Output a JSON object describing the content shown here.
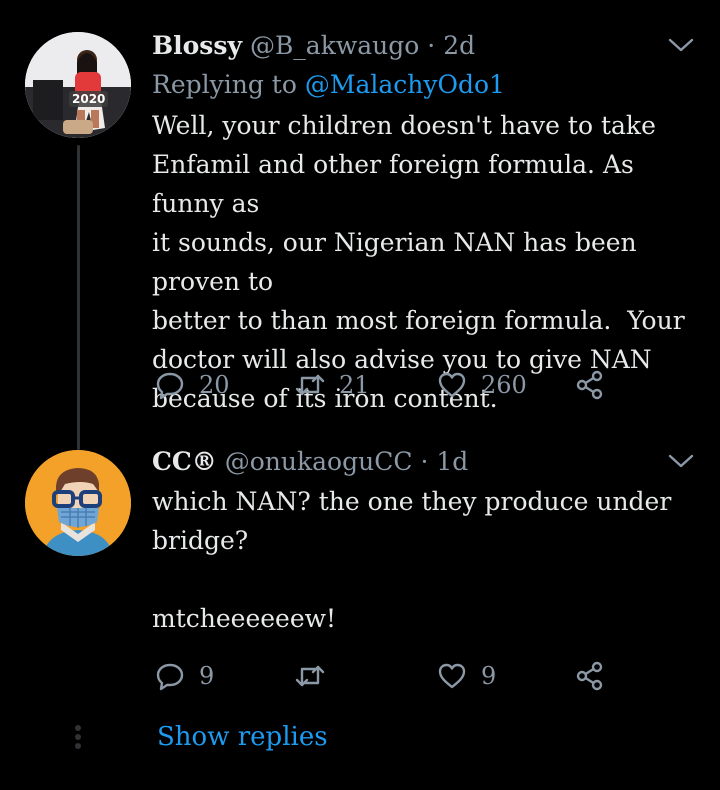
{
  "tweets": [
    {
      "name": "Blossy",
      "handle": "@B_akwaugo",
      "dot": "·",
      "time": "2d",
      "reply_label": "Replying to",
      "reply_mention": "@MalachyOdo1",
      "text": "Well, your children doesn't have to take\nEnfamil and other foreign formula. As funny as\nit sounds, our Nigerian NAN has been proven to\nbetter to than most foreign formula.  Your\ndoctor will also advise you to give NAN\nbecause of its iron content.",
      "replies": "20",
      "retweets": "21",
      "likes": "260",
      "avatar_badge": "2020"
    },
    {
      "name": "CC®",
      "handle": "@onukaoguCC",
      "dot": "·",
      "time": "1d",
      "text": "which NAN? the one they produce under\nbridge?\n\nmtcheeeeeew!",
      "replies": "9",
      "retweets": "",
      "likes": "9"
    }
  ],
  "show_replies": "Show replies",
  "icons": {
    "reply": "reply-icon",
    "retweet": "retweet-icon",
    "like": "heart-icon",
    "share": "share-icon",
    "more": "chevron-down-icon"
  },
  "colors": {
    "background": "#000000",
    "text": "#e7e9ea",
    "muted": "#8b98a5",
    "link": "#1d9bf0",
    "avatar2_bg": "#f4a12a"
  }
}
